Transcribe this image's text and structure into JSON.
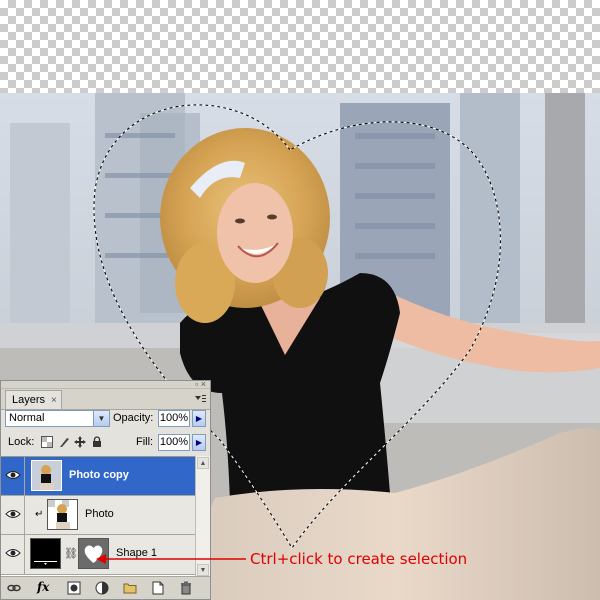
{
  "palette": {
    "tab_label": "Layers",
    "tab_close": "×",
    "blend_mode": "Normal",
    "opacity_label": "Opacity:",
    "opacity_value": "100%",
    "lock_label": "Lock:",
    "fill_label": "Fill:",
    "fill_value": "100%",
    "layers": [
      {
        "name": "Photo copy",
        "selected": true,
        "visible": true
      },
      {
        "name": "Photo",
        "selected": false,
        "visible": true
      },
      {
        "name": "Shape 1",
        "selected": false,
        "visible": true
      }
    ],
    "bottom_icons": [
      "link-layers-icon",
      "fx-icon",
      "layer-mask-icon",
      "adjustment-layer-icon",
      "new-group-icon",
      "new-layer-icon",
      "trash-icon"
    ],
    "fx_label": "fx"
  },
  "annotation": {
    "text": "Ctrl+click to create selection",
    "color": "#e00000"
  },
  "colors": {
    "selected_layer": "#3167c9",
    "palette_bg": "#e4e2dc"
  }
}
